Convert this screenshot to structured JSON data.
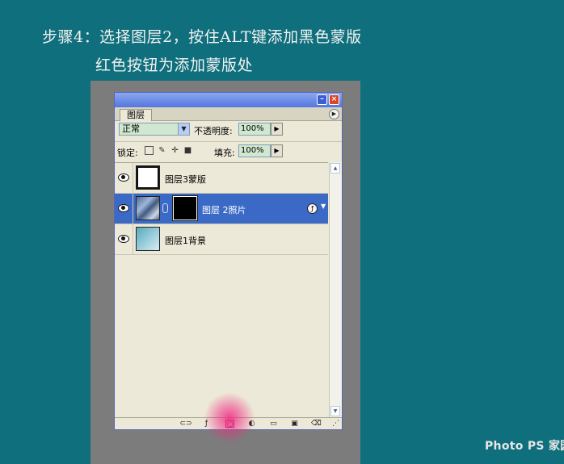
{
  "instructions": {
    "line1": "步骤4：选择图层2，按住ALT键添加黑色蒙版",
    "line2": "红色按钮为添加蒙版处"
  },
  "panel": {
    "tab_label": "图层",
    "blend_mode": "正常",
    "opacity_label": "不透明度:",
    "opacity_value": "100%",
    "lock_label": "锁定:",
    "fill_label": "填充:",
    "fill_value": "100%",
    "layers": [
      {
        "name": "图层3蒙版",
        "visible": true,
        "selected": false
      },
      {
        "name": "图层 2照片",
        "visible": true,
        "selected": true,
        "has_mask": true
      },
      {
        "name": "图层1背景",
        "visible": true,
        "selected": false
      }
    ],
    "highlight_color": "#ff2d8a",
    "selection_color": "#3a6ac6",
    "bottom_icons": [
      "link-icon",
      "fx-icon",
      "add-mask-icon",
      "adjustment-icon",
      "folder-icon",
      "new-layer-icon",
      "trash-icon"
    ]
  },
  "watermark": {
    "text": "Photo PS 家园"
  }
}
